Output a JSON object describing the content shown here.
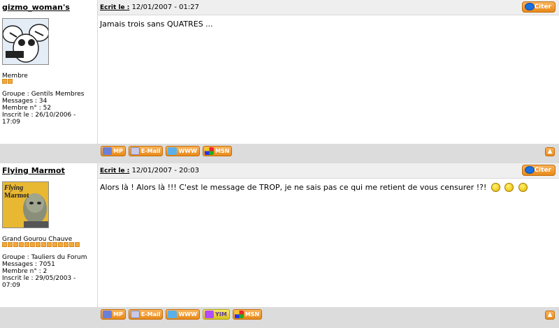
{
  "posts": [
    {
      "username": "gizmo_woman's",
      "written_label": "Ecrit le :",
      "date": "12/01/2007 - 01:27",
      "quote_label": "Citer",
      "rank": "Membre",
      "rank_level": 2,
      "stats": [
        "Groupe : Gentils Membres",
        "Messages : 34",
        "Membre n° : 52",
        "Inscrit le : 26/10/2006 - 17:09"
      ],
      "message": "Jamais trois sans QUATRES ...",
      "buttons": {
        "mp": "MP",
        "email": "E-Mail",
        "www": "WWW",
        "msn": "MSN"
      }
    },
    {
      "username": "Flying Marmot",
      "written_label": "Ecrit le :",
      "date": "12/01/2007 - 20:03",
      "quote_label": "Citer",
      "rank": "Grand Gourou Chauve",
      "rank_level": 14,
      "stats": [
        "Groupe : Tauliers du Forum",
        "Messages : 7051",
        "Membre n° : 2",
        "Inscrit le : 29/05/2003 - 07:09"
      ],
      "message": "Alors là ! Alors là !!! C'est le message de TROP, je ne sais pas ce qui me retient de vous censurer !?!",
      "avatar_text": [
        "Flying",
        "Marmot"
      ],
      "buttons": {
        "mp": "MP",
        "email": "E-Mail",
        "www": "WWW",
        "yim": "YIM",
        "msn": "MSN"
      }
    }
  ]
}
